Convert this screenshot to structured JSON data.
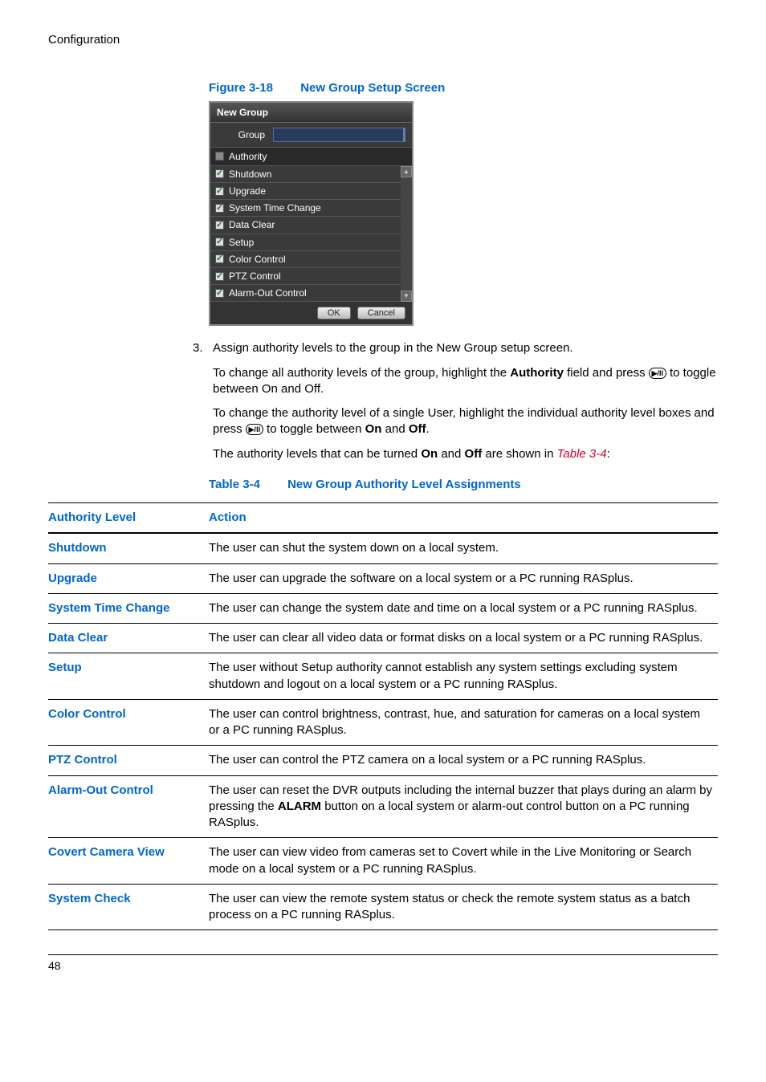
{
  "header": {
    "section": "Configuration"
  },
  "figure": {
    "label": "Figure 3-18",
    "title": "New Group Setup Screen"
  },
  "dialog": {
    "title": "New Group",
    "groupLabel": "Group",
    "authorityLabel": "Authority",
    "items": [
      "Shutdown",
      "Upgrade",
      "System Time Change",
      "Data Clear",
      "Setup",
      "Color Control",
      "PTZ Control",
      "Alarm-Out Control"
    ],
    "ok": "OK",
    "cancel": "Cancel"
  },
  "step": {
    "num": "3.",
    "line1": "Assign authority levels to the group in the New Group setup screen.",
    "p2a": "To change all authority levels of the group, highlight the ",
    "p2bold": "Authority",
    "p2b": " field and press ",
    "iconText": "▶/II",
    "p2c": " to toggle between On and Off.",
    "p3a": "To change the authority level of a single User, highlight the individual authority level boxes and press ",
    "p3b": " to toggle between ",
    "on": "On",
    "and": " and ",
    "off": "Off",
    "p3c": ".",
    "p4a": "The authority levels that can be turned ",
    "p4b": " are shown in ",
    "tableRef": "Table 3-4",
    "p4c": ":"
  },
  "tableCaption": {
    "label": "Table 3-4",
    "title": "New Group Authority Level Assignments"
  },
  "tableHeaders": {
    "level": "Authority Level",
    "action": "Action"
  },
  "rows": [
    {
      "level": "Shutdown",
      "action": "The user can shut the system down on a local system."
    },
    {
      "level": "Upgrade",
      "action": "The user can upgrade the software on a local system or a PC running RASplus."
    },
    {
      "level": "System Time Change",
      "action": "The user can change the system date and time on a local system or a PC running RASplus."
    },
    {
      "level": "Data Clear",
      "action": "The user can clear all video data or format disks on a local system or a PC running RASplus."
    },
    {
      "level": "Setup",
      "action": "The user without Setup authority cannot establish any system settings excluding system shutdown and logout on a local system or a PC running RASplus."
    },
    {
      "level": "Color Control",
      "action": "The user can control brightness, contrast, hue, and saturation for cameras on a local system or a PC running RASplus."
    },
    {
      "level": "PTZ Control",
      "action": "The user can control the PTZ camera on a local system or a PC running RASplus."
    },
    {
      "level": "Alarm-Out Control",
      "action_parts": [
        "The user can reset the DVR outputs including the internal buzzer that plays during an alarm by pressing the ",
        "ALARM",
        " button on a local system or alarm-out control button on a PC running RASplus."
      ]
    },
    {
      "level": "Covert Camera View",
      "action": "The user can view video from cameras set to Covert while in the Live Monitoring or Search mode on a local system or a PC running RASplus."
    },
    {
      "level": "System Check",
      "action": "The user can view the remote system status or check the remote system status as a batch process on a PC running RASplus."
    }
  ],
  "footer": {
    "page": "48"
  }
}
